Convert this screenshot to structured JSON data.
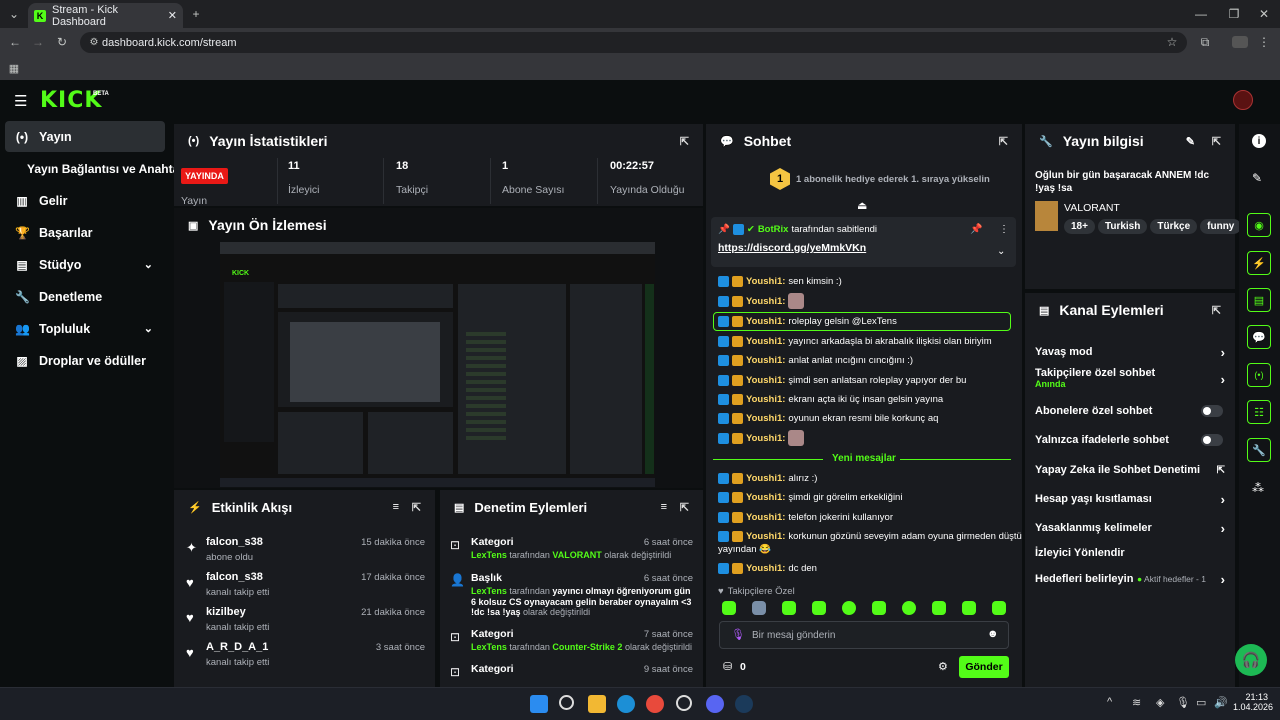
{
  "browser": {
    "tab_title": "Stream - Kick Dashboard",
    "url": "dashboard.kick.com/stream"
  },
  "header": {
    "logo": "KICK",
    "beta": "BETA"
  },
  "sidebar": {
    "items": [
      {
        "label": "Yayın",
        "icon": "broadcast-icon"
      },
      {
        "label": "Yayın Bağlantısı ve Anahtarı",
        "icon": ""
      },
      {
        "label": "Gelir",
        "icon": "revenue-icon"
      },
      {
        "label": "Başarılar",
        "icon": "trophy-icon"
      },
      {
        "label": "Stüdyo",
        "icon": "studio-icon"
      },
      {
        "label": "Denetleme",
        "icon": "wrench-icon"
      },
      {
        "label": "Topluluk",
        "icon": "community-icon"
      },
      {
        "label": "Droplar ve ödüller",
        "icon": "drops-icon"
      }
    ]
  },
  "stats": {
    "title": "Yayın İstatistikleri",
    "live_badge": "YAYINDA",
    "live_label": "Yayın",
    "viewers": {
      "value": "11",
      "label": "İzleyici"
    },
    "followers": {
      "value": "18",
      "label": "Takipçi"
    },
    "subs": {
      "value": "1",
      "label": "Abone Sayısı"
    },
    "uptime": {
      "value": "00:22:57",
      "label": "Yayında Olduğu"
    }
  },
  "preview": {
    "title": "Yayın Ön İzlemesi"
  },
  "activity": {
    "title": "Etkinlik Akışı",
    "items": [
      {
        "name": "falcon_s38",
        "action": "abone oldu",
        "time": "15 dakika önce"
      },
      {
        "name": "falcon_s38",
        "action": "kanalı takip etti",
        "time": "17 dakika önce"
      },
      {
        "name": "kizilbey",
        "action": "kanalı takip etti",
        "time": "21 dakika önce"
      },
      {
        "name": "A_R_D_A_1",
        "action": "kanalı takip etti",
        "time": "3 saat önce"
      }
    ]
  },
  "moderation": {
    "title": "Denetim Eylemleri",
    "items": [
      {
        "kind": "Kategori",
        "time": "6 saat önce",
        "user": "LexTens",
        "mid": "tarafından",
        "value": "VALORANT",
        "end": "olarak değiştirildi"
      },
      {
        "kind": "Başlık",
        "time": "6 saat önce",
        "user": "LexTens",
        "mid": "tarafından",
        "value": "yayıncı olmayı öğreniyorum gün 6 kolsuz CS oynayacam gelin beraber oynayalım <3 !dc !sa !yaş",
        "end": "olarak değiştirildi"
      },
      {
        "kind": "Kategori",
        "time": "7 saat önce",
        "user": "LexTens",
        "mid": "tarafından",
        "value": "Counter-Strike 2",
        "end": "olarak değiştirildi"
      },
      {
        "kind": "Kategori",
        "time": "9 saat önce",
        "user": "",
        "mid": "",
        "value": "",
        "end": ""
      }
    ]
  },
  "chat": {
    "title": "Sohbet",
    "goal_num": "1",
    "goal_text": "1 abonelik hediye ederek 1. sıraya yükselin",
    "pinned_by": "BotRix",
    "pinned_suffix": "tarafından sabitlendi",
    "pinned_link": "https://discord.gg/yeMmkVKn",
    "messages": [
      {
        "user": "Youshi1:",
        "text": "sen kimsin :)",
        "emote": false
      },
      {
        "user": "Youshi1:",
        "text": "",
        "emote": true
      },
      {
        "user": "Youshi1:",
        "text": "roleplay gelsin @LexTens",
        "emote": false
      },
      {
        "user": "Youshi1:",
        "text": "yayıncı arkadaşla bi akrabalık ilişkisi olan biriyim",
        "emote": false
      },
      {
        "user": "Youshi1:",
        "text": "anlat anlat ıncığını cıncığını :)",
        "emote": false
      },
      {
        "user": "Youshi1:",
        "text": "şimdi sen anlatsan roleplay yapıyor der bu",
        "emote": false
      },
      {
        "user": "Youshi1:",
        "text": "ekranı açta iki üç insan gelsin yayına",
        "emote": false
      },
      {
        "user": "Youshi1:",
        "text": "oyunun ekran resmi bile korkunç aq",
        "emote": false
      },
      {
        "user": "Youshi1:",
        "text": "",
        "emote": true
      }
    ],
    "new_messages": "Yeni mesajlar",
    "messages2": [
      {
        "user": "Youshi1:",
        "text": "alırız :)"
      },
      {
        "user": "Youshi1:",
        "text": "şimdi gir görelim erkekliğini"
      },
      {
        "user": "Youshi1:",
        "text": "telefon jokerini kullanıyor"
      },
      {
        "user": "Youshi1:",
        "text": "korkunun gözünü seveyim adam oyuna girmeden düştü"
      },
      {
        "user": "Youshi1:",
        "text": "dc den"
      }
    ],
    "msg_cont": "yayından 😂",
    "follower_only": "Takipçilere Özel",
    "input_placeholder": "Bir mesaj gönderin",
    "points": "0",
    "send": "Gönder"
  },
  "stream_info": {
    "title": "Yayın bilgisi",
    "stream_title": "Oğlun bir gün başaracak ANNEM !dc !yaş !sa",
    "category": "VALORANT",
    "tags": [
      "18+",
      "Turkish",
      "Türkçe",
      "funny"
    ]
  },
  "channel_actions": {
    "title": "Kanal Eylemleri",
    "slow": "Yavaş mod",
    "followers_only": "Takipçilere özel sohbet",
    "followers_only_sub": "Anında",
    "subs_only": "Abonelere özel sohbet",
    "emotes_only": "Yalnızca ifadelerle sohbet",
    "ai_mod": "Yapay Zeka ile Sohbet Denetimi",
    "age": "Hesap yaşı kısıtlaması",
    "banned_words": "Yasaklanmış kelimeler",
    "redirect": "İzleyici Yönlendir",
    "goals": "Hedefleri belirleyin",
    "goals_status": "Aktif hedefler - 1"
  },
  "taskbar": {
    "time": "21:13",
    "date": "1.04.2026"
  },
  "colors": {
    "accent": "#53fc18",
    "panel": "#191b1f",
    "bg": "#0b0e0f",
    "live": "#e91916"
  }
}
